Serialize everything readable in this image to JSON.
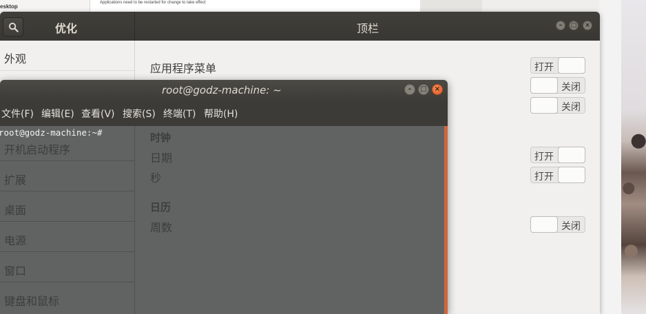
{
  "background_window": {
    "label": "esktop",
    "info_text": "Applications need to be restarted for change to take effect"
  },
  "tweaks": {
    "app_title": "优化",
    "page_title": "顶栏",
    "sidebar": {
      "items": [
        {
          "label": "外观"
        },
        {
          "label": "开机启动程序"
        },
        {
          "label": "扩展"
        },
        {
          "label": "桌面"
        },
        {
          "label": "电源"
        },
        {
          "label": "窗口"
        },
        {
          "label": "键盘和鼠标"
        }
      ]
    },
    "content": {
      "app_menu_label": "应用程序菜单",
      "clock_section": "时钟",
      "date_label": "日期",
      "seconds_label": "秒",
      "calendar_section": "日历",
      "week_label": "周数",
      "switches": {
        "app_menu": {
          "state": "on",
          "text": "打开"
        },
        "hidden_1": {
          "state": "off",
          "text": "关闭"
        },
        "hidden_2": {
          "state": "off",
          "text": "关闭"
        },
        "date": {
          "state": "on",
          "text": "打开"
        },
        "seconds": {
          "state": "on",
          "text": "打开"
        },
        "week": {
          "state": "off",
          "text": "关闭"
        }
      }
    }
  },
  "terminal": {
    "title": "root@godz-machine: ~",
    "menu": [
      {
        "label": "文件(F)"
      },
      {
        "label": "编辑(E)"
      },
      {
        "label": "查看(V)"
      },
      {
        "label": "搜索(S)"
      },
      {
        "label": "终端(T)"
      },
      {
        "label": "帮助(H)"
      }
    ],
    "prompt": "root@godz-machine:~#"
  },
  "colors": {
    "header_dark": "#3c3b37",
    "terminal_close": "#e05a25",
    "terminal_scrollbar": "#d06540"
  }
}
